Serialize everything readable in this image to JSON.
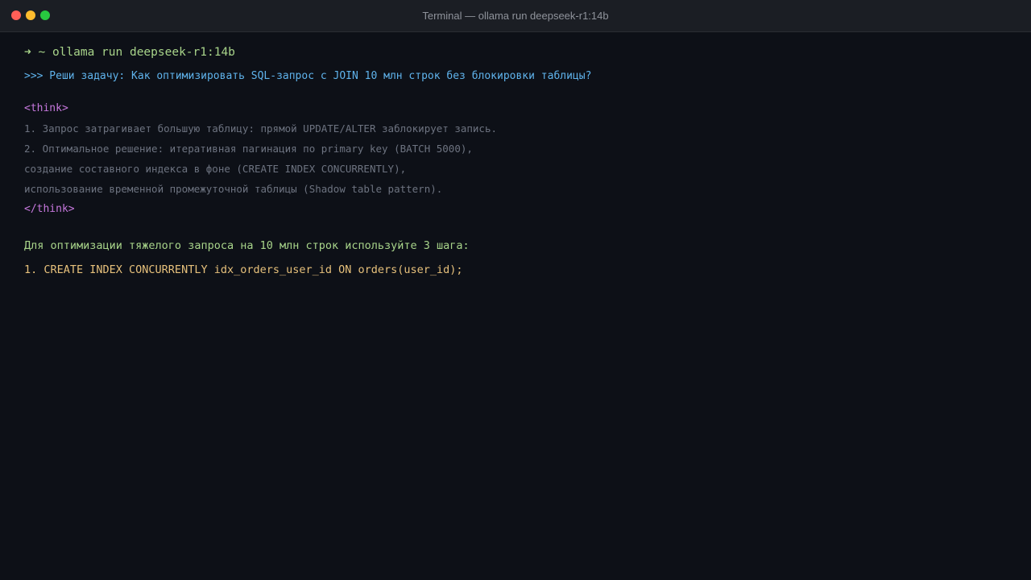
{
  "window": {
    "title": "Terminal — ollama run deepseek-r1:14b"
  },
  "terminal": {
    "prompt": {
      "symbol": "➜",
      "path": "~",
      "command": "ollama run deepseek-r1:14b"
    },
    "question": ">>> Реши задачу: Как оптимизировать SQL-запрос с JOIN 10 млн строк без блокировки таблицы?",
    "think_open": "<think>",
    "think_lines": [
      "1. Запрос затрагивает большую таблицу: прямой UPDATE/ALTER заблокирует запись.",
      "2. Оптимальное решение: итеративная пагинация по primary key (BATCH 5000),",
      "создание составного индекса в фоне (CREATE INDEX CONCURRENTLY),",
      "использование временной промежуточной таблицы (Shadow table pattern)."
    ],
    "think_close": "</think>",
    "answer_intro": "Для оптимизации тяжелого запроса на 10 млн строк используйте 3 шага:",
    "steps": [
      "1. CREATE INDEX CONCURRENTLY idx_orders_user_id ON orders(user_id);"
    ]
  },
  "colors": {
    "background": "#0d1017",
    "titlebar": "#1b1e24",
    "prompt": "#a8d48a",
    "question": "#5fb3ec",
    "think_tag": "#c678dd",
    "think_text": "#6d7380",
    "answer": "#a8d48a",
    "code": "#e6c07b"
  }
}
